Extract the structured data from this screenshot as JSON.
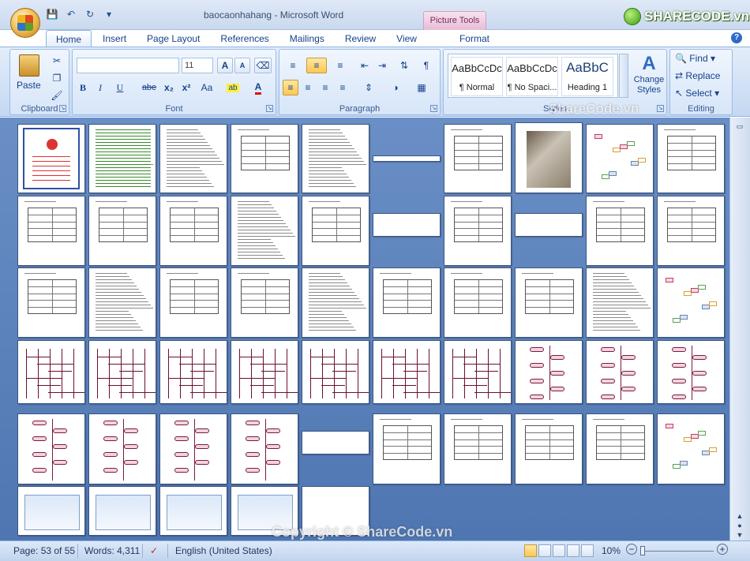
{
  "window": {
    "title": "baocaonhahang - Microsoft Word",
    "context_tab_group": "Picture Tools"
  },
  "brand": {
    "logo_text": "SHARECODE.vn"
  },
  "tabs": [
    {
      "label": "Home",
      "active": true
    },
    {
      "label": "Insert"
    },
    {
      "label": "Page Layout"
    },
    {
      "label": "References"
    },
    {
      "label": "Mailings"
    },
    {
      "label": "Review"
    },
    {
      "label": "View"
    },
    {
      "label": "Format"
    }
  ],
  "ribbon": {
    "clipboard": {
      "label": "Clipboard",
      "paste": "Paste"
    },
    "font": {
      "label": "Font",
      "name": "",
      "size": "11",
      "bold": "B",
      "italic": "I",
      "underline": "U",
      "strike": "abe",
      "sub": "x₂",
      "sup": "x²",
      "case": "Aa",
      "grow": "A",
      "shrink": "A"
    },
    "paragraph": {
      "label": "Paragraph"
    },
    "styles": {
      "label": "Styles",
      "items": [
        {
          "sample": "AaBbCcDc",
          "name": "¶ Normal"
        },
        {
          "sample": "AaBbCcDc",
          "name": "¶ No Spaci..."
        },
        {
          "sample": "AaBbC",
          "name": "Heading 1"
        }
      ],
      "change": "Change Styles"
    },
    "editing": {
      "label": "Editing",
      "find": "Find",
      "replace": "Replace",
      "select": "Select"
    }
  },
  "status": {
    "page": "Page: 53 of 55",
    "words": "Words: 4,311",
    "language": "English (United States)",
    "zoom": "10%"
  },
  "watermarks": {
    "top": "ShareCode.vn",
    "bottom": "Copyright © ShareCode.vn"
  }
}
